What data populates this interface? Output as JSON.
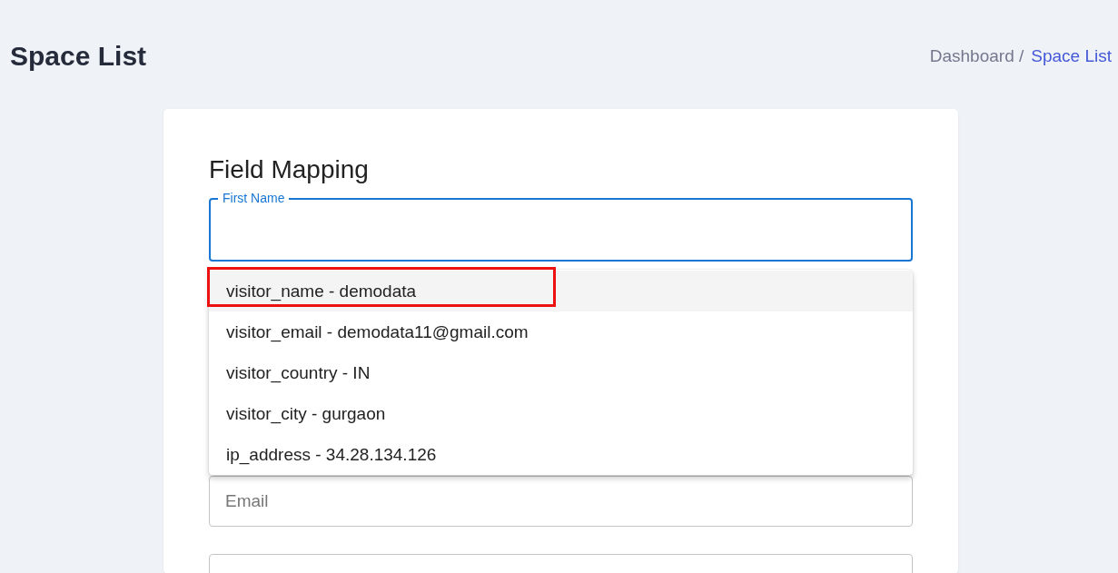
{
  "page_title": "Space List",
  "breadcrumb": [
    {
      "label": "Dashboard /",
      "selected": false
    },
    {
      "label": "Space List",
      "selected": true
    }
  ],
  "card": {
    "title": "Field Mapping",
    "fields": [
      {
        "kind": "labelled",
        "label": "First Name",
        "focused": true
      },
      {
        "kind": "placeholder",
        "placeholder": "Email",
        "focused": false
      },
      {
        "kind": "empty",
        "focused": false
      }
    ],
    "options": [
      {
        "label": "visitor_name - demodata",
        "highlighted": true,
        "outlined": true
      },
      {
        "label": "visitor_email - demodata11@gmail.com",
        "highlighted": false,
        "outlined": false
      },
      {
        "label": "visitor_country - IN",
        "highlighted": false,
        "outlined": false
      },
      {
        "label": "visitor_city - gurgaon",
        "highlighted": false,
        "outlined": false
      },
      {
        "label": "ip_address - 34.28.134.126",
        "highlighted": false,
        "outlined": false
      }
    ]
  }
}
